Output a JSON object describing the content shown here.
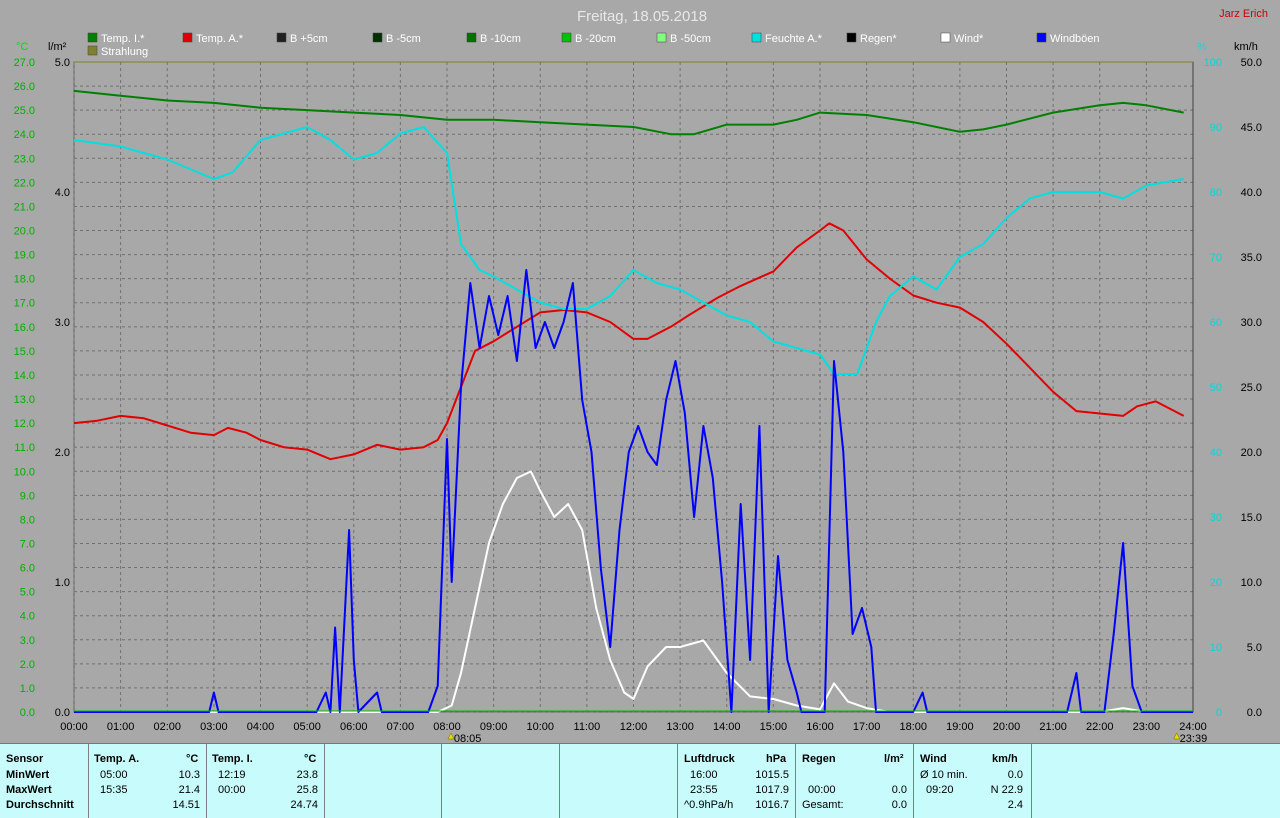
{
  "header": {
    "title": "Freitag, 18.05.2018",
    "author": "Jarz Erich"
  },
  "legend": [
    {
      "label": "Temp. I.*",
      "color": "#008000"
    },
    {
      "label": "Temp. A.*",
      "color": "#e00000"
    },
    {
      "label": "B +5cm",
      "color": "#202020"
    },
    {
      "label": "B -5cm",
      "color": "#003000"
    },
    {
      "label": "B -10cm",
      "color": "#007000"
    },
    {
      "label": "B -20cm",
      "color": "#00c000"
    },
    {
      "label": "B -50cm",
      "color": "#80ff80"
    },
    {
      "label": "Feuchte A.*",
      "color": "#00e0e0"
    },
    {
      "label": "Regen*",
      "color": "#000000"
    },
    {
      "label": "Wind*",
      "color": "#ffffff"
    },
    {
      "label": "Windböen",
      "color": "#0000ff"
    },
    {
      "label": "Strahlung",
      "color": "#808030"
    }
  ],
  "axes": {
    "left_unit": "°C",
    "rain_unit": "l/m²",
    "hum_unit": "%",
    "wind_unit": "km/h",
    "temp_ticks": [
      "27.0",
      "26.0",
      "25.0",
      "24.0",
      "23.0",
      "22.0",
      "21.0",
      "20.0",
      "19.0",
      "18.0",
      "17.0",
      "16.0",
      "15.0",
      "14.0",
      "13.0",
      "12.0",
      "11.0",
      "10.0",
      "9.0",
      "8.0",
      "7.0",
      "6.0",
      "5.0",
      "4.0",
      "3.0",
      "2.0",
      "1.0",
      "0.0"
    ],
    "rain_ticks": [
      "5.0",
      "4.0",
      "3.0",
      "2.0",
      "1.0",
      "0.0"
    ],
    "hum_ticks": [
      "100",
      "90",
      "80",
      "70",
      "60",
      "50",
      "40",
      "30",
      "20",
      "10",
      "0"
    ],
    "wind_ticks": [
      "50.0",
      "45.0",
      "40.0",
      "35.0",
      "30.0",
      "25.0",
      "20.0",
      "15.0",
      "10.0",
      "5.0",
      "0.0"
    ],
    "time_ticks": [
      "00:00",
      "01:00",
      "02:00",
      "03:00",
      "04:00",
      "05:00",
      "06:00",
      "07:00",
      "08:00",
      "09:00",
      "10:00",
      "11:00",
      "12:00",
      "13:00",
      "14:00",
      "15:00",
      "16:00",
      "17:00",
      "18:00",
      "19:00",
      "20:00",
      "21:00",
      "22:00",
      "23:00",
      "24:00"
    ],
    "sunrise": "08:05",
    "sunset": "23:39"
  },
  "chart_data": {
    "type": "line",
    "title": "Freitag, 18.05.2018",
    "xlim": [
      0,
      24
    ],
    "ylim_temp": [
      0,
      27
    ],
    "ylim_rain": [
      0,
      5
    ],
    "ylim_humidity": [
      0,
      100
    ],
    "ylim_wind": [
      0,
      50
    ],
    "grid": true,
    "series": [
      {
        "name": "Temp. I.*",
        "axis": "temp",
        "color": "#008000",
        "points": [
          [
            0,
            25.8
          ],
          [
            1,
            25.6
          ],
          [
            2,
            25.4
          ],
          [
            3,
            25.3
          ],
          [
            4,
            25.1
          ],
          [
            5,
            25.0
          ],
          [
            6,
            24.9
          ],
          [
            7,
            24.8
          ],
          [
            8,
            24.6
          ],
          [
            9,
            24.6
          ],
          [
            10,
            24.5
          ],
          [
            11,
            24.4
          ],
          [
            12,
            24.3
          ],
          [
            12.8,
            24.0
          ],
          [
            13.3,
            24.0
          ],
          [
            14,
            24.4
          ],
          [
            15,
            24.4
          ],
          [
            15.5,
            24.6
          ],
          [
            16,
            24.9
          ],
          [
            17,
            24.8
          ],
          [
            18,
            24.5
          ],
          [
            19,
            24.1
          ],
          [
            19.5,
            24.2
          ],
          [
            20,
            24.4
          ],
          [
            21,
            24.9
          ],
          [
            22,
            25.2
          ],
          [
            22.5,
            25.3
          ],
          [
            23,
            25.2
          ],
          [
            23.8,
            24.9
          ]
        ]
      },
      {
        "name": "Temp. A.*",
        "axis": "temp",
        "color": "#e00000",
        "points": [
          [
            0,
            12.0
          ],
          [
            0.5,
            12.1
          ],
          [
            1,
            12.3
          ],
          [
            1.5,
            12.2
          ],
          [
            2,
            11.9
          ],
          [
            2.5,
            11.6
          ],
          [
            3,
            11.5
          ],
          [
            3.3,
            11.8
          ],
          [
            3.7,
            11.6
          ],
          [
            4,
            11.3
          ],
          [
            4.5,
            11.0
          ],
          [
            5,
            10.9
          ],
          [
            5.5,
            10.5
          ],
          [
            6,
            10.7
          ],
          [
            6.5,
            11.1
          ],
          [
            7,
            10.9
          ],
          [
            7.5,
            11.0
          ],
          [
            7.8,
            11.3
          ],
          [
            8,
            12.0
          ],
          [
            8.3,
            13.5
          ],
          [
            8.6,
            15.0
          ],
          [
            9,
            15.4
          ],
          [
            9.5,
            16.0
          ],
          [
            10,
            16.6
          ],
          [
            10.5,
            16.7
          ],
          [
            11,
            16.6
          ],
          [
            11.5,
            16.2
          ],
          [
            12,
            15.5
          ],
          [
            12.3,
            15.5
          ],
          [
            12.8,
            16.0
          ],
          [
            13.2,
            16.5
          ],
          [
            13.8,
            17.2
          ],
          [
            14.3,
            17.7
          ],
          [
            15,
            18.3
          ],
          [
            15.5,
            19.3
          ],
          [
            16,
            20.0
          ],
          [
            16.2,
            20.3
          ],
          [
            16.5,
            20.0
          ],
          [
            17,
            18.8
          ],
          [
            17.5,
            18.0
          ],
          [
            18,
            17.3
          ],
          [
            18.5,
            17.0
          ],
          [
            19,
            16.8
          ],
          [
            19.5,
            16.2
          ],
          [
            20,
            15.3
          ],
          [
            20.5,
            14.3
          ],
          [
            21,
            13.3
          ],
          [
            21.5,
            12.5
          ],
          [
            22,
            12.4
          ],
          [
            22.5,
            12.3
          ],
          [
            22.8,
            12.7
          ],
          [
            23.2,
            12.9
          ],
          [
            23.8,
            12.3
          ]
        ]
      },
      {
        "name": "Feuchte A.*",
        "axis": "humidity",
        "color": "#00e0e0",
        "points": [
          [
            0,
            88
          ],
          [
            1,
            87
          ],
          [
            2,
            85
          ],
          [
            3,
            82
          ],
          [
            3.4,
            83
          ],
          [
            4,
            88
          ],
          [
            5,
            90
          ],
          [
            5.5,
            88
          ],
          [
            6,
            85
          ],
          [
            6.5,
            86
          ],
          [
            7,
            89
          ],
          [
            7.5,
            90
          ],
          [
            8,
            86
          ],
          [
            8.3,
            72
          ],
          [
            8.7,
            68
          ],
          [
            9,
            67
          ],
          [
            9.5,
            65
          ],
          [
            10,
            63
          ],
          [
            10.5,
            62
          ],
          [
            11,
            62
          ],
          [
            11.5,
            64
          ],
          [
            12,
            68
          ],
          [
            12.5,
            66
          ],
          [
            13,
            65
          ],
          [
            13.5,
            63
          ],
          [
            14,
            61
          ],
          [
            14.5,
            60
          ],
          [
            15,
            57
          ],
          [
            15.5,
            56
          ],
          [
            16,
            55
          ],
          [
            16.3,
            52
          ],
          [
            16.8,
            52
          ],
          [
            17.2,
            60
          ],
          [
            17.5,
            64
          ],
          [
            18,
            67
          ],
          [
            18.5,
            65
          ],
          [
            19,
            70
          ],
          [
            19.5,
            72
          ],
          [
            20,
            76
          ],
          [
            20.5,
            79
          ],
          [
            21,
            80
          ],
          [
            21.5,
            80
          ],
          [
            22,
            80
          ],
          [
            22.5,
            79
          ],
          [
            23,
            81
          ],
          [
            23.8,
            82
          ]
        ]
      },
      {
        "name": "Strahlung",
        "axis": "rain",
        "color": "#808030",
        "points": [
          [
            0,
            5.0
          ],
          [
            24,
            5.0
          ]
        ]
      },
      {
        "name": "Wind*",
        "axis": "wind",
        "color": "#ffffff",
        "points": [
          [
            0,
            0
          ],
          [
            7.8,
            0
          ],
          [
            8.1,
            0.5
          ],
          [
            8.3,
            3
          ],
          [
            8.6,
            8
          ],
          [
            8.9,
            13
          ],
          [
            9.2,
            16
          ],
          [
            9.5,
            18
          ],
          [
            9.8,
            18.5
          ],
          [
            10,
            17
          ],
          [
            10.3,
            15
          ],
          [
            10.6,
            16
          ],
          [
            10.9,
            14
          ],
          [
            11.2,
            8
          ],
          [
            11.5,
            4
          ],
          [
            11.8,
            1.5
          ],
          [
            12,
            1
          ],
          [
            12.3,
            3.5
          ],
          [
            12.7,
            5
          ],
          [
            13,
            5
          ],
          [
            13.5,
            5.5
          ],
          [
            14,
            3
          ],
          [
            14.5,
            1.2
          ],
          [
            15,
            1
          ],
          [
            15.5,
            0.5
          ],
          [
            16,
            0.2
          ],
          [
            16.3,
            2.2
          ],
          [
            16.6,
            0.8
          ],
          [
            17,
            0.3
          ],
          [
            17.5,
            0
          ],
          [
            22,
            0
          ],
          [
            22.5,
            0.3
          ],
          [
            23,
            0
          ]
        ]
      },
      {
        "name": "Windböen",
        "axis": "wind",
        "color": "#0000ff",
        "points": [
          [
            0,
            0
          ],
          [
            2.9,
            0
          ],
          [
            3.0,
            1.5
          ],
          [
            3.1,
            0
          ],
          [
            5.2,
            0
          ],
          [
            5.4,
            1.5
          ],
          [
            5.5,
            0
          ],
          [
            5.6,
            6.5
          ],
          [
            5.7,
            0
          ],
          [
            5.9,
            14
          ],
          [
            6.0,
            4
          ],
          [
            6.1,
            0
          ],
          [
            6.5,
            1.5
          ],
          [
            6.6,
            0
          ],
          [
            7.6,
            0
          ],
          [
            7.8,
            2
          ],
          [
            8.0,
            21
          ],
          [
            8.1,
            10
          ],
          [
            8.3,
            25
          ],
          [
            8.5,
            33
          ],
          [
            8.7,
            28
          ],
          [
            8.9,
            32
          ],
          [
            9.1,
            29
          ],
          [
            9.3,
            32
          ],
          [
            9.5,
            27
          ],
          [
            9.7,
            34
          ],
          [
            9.9,
            28
          ],
          [
            10.1,
            30
          ],
          [
            10.3,
            28
          ],
          [
            10.5,
            30
          ],
          [
            10.7,
            33
          ],
          [
            10.9,
            24
          ],
          [
            11.1,
            20
          ],
          [
            11.3,
            11
          ],
          [
            11.5,
            5
          ],
          [
            11.7,
            14
          ],
          [
            11.9,
            20
          ],
          [
            12.1,
            22
          ],
          [
            12.3,
            20
          ],
          [
            12.5,
            19
          ],
          [
            12.7,
            24
          ],
          [
            12.9,
            27
          ],
          [
            13.1,
            23
          ],
          [
            13.3,
            15
          ],
          [
            13.5,
            22
          ],
          [
            13.7,
            18
          ],
          [
            13.9,
            10
          ],
          [
            14.1,
            0
          ],
          [
            14.3,
            16
          ],
          [
            14.5,
            4
          ],
          [
            14.7,
            22
          ],
          [
            14.9,
            0
          ],
          [
            15.1,
            12
          ],
          [
            15.3,
            4
          ],
          [
            15.5,
            1.5
          ],
          [
            15.6,
            0
          ],
          [
            16.1,
            0
          ],
          [
            16.3,
            27
          ],
          [
            16.5,
            20
          ],
          [
            16.7,
            6
          ],
          [
            16.9,
            8
          ],
          [
            17.1,
            5
          ],
          [
            17.2,
            0
          ],
          [
            18.0,
            0
          ],
          [
            18.2,
            1.5
          ],
          [
            18.3,
            0
          ],
          [
            21.3,
            0
          ],
          [
            21.5,
            3
          ],
          [
            21.6,
            0
          ],
          [
            22.1,
            0
          ],
          [
            22.3,
            6
          ],
          [
            22.5,
            13
          ],
          [
            22.7,
            2
          ],
          [
            22.9,
            0
          ],
          [
            24,
            0
          ]
        ]
      }
    ]
  },
  "table": {
    "sensor": {
      "header": "Sensor",
      "rows": [
        "MinWert",
        "MaxWert",
        "Durchschnitt"
      ]
    },
    "temp_a": {
      "header": "Temp. A.",
      "unit": "°C",
      "rows": [
        [
          "05:00",
          "10.3"
        ],
        [
          "15:35",
          "21.4"
        ],
        [
          "",
          "14.51"
        ]
      ]
    },
    "temp_i": {
      "header": "Temp. I.",
      "unit": "°C",
      "rows": [
        [
          "12:19",
          "23.8"
        ],
        [
          "00:00",
          "25.8"
        ],
        [
          "",
          "24.74"
        ]
      ]
    },
    "pressure": {
      "header": "Luftdruck",
      "unit": "hPa",
      "rows": [
        [
          "16:00",
          "1015.5"
        ],
        [
          "23:55",
          "1017.9"
        ],
        [
          "^0.9hPa/h",
          "1016.7"
        ]
      ]
    },
    "rain": {
      "header": "Regen",
      "unit": "l/m²",
      "rows": [
        [
          "",
          ""
        ],
        [
          "00:00",
          "0.0"
        ],
        [
          "Gesamt:",
          "0.0"
        ]
      ]
    },
    "wind": {
      "header": "Wind",
      "unit": "km/h",
      "rows": [
        [
          "Ø 10 min.",
          "0.0"
        ],
        [
          "09:20",
          "N 22.9"
        ],
        [
          "",
          "2.4"
        ]
      ]
    }
  }
}
